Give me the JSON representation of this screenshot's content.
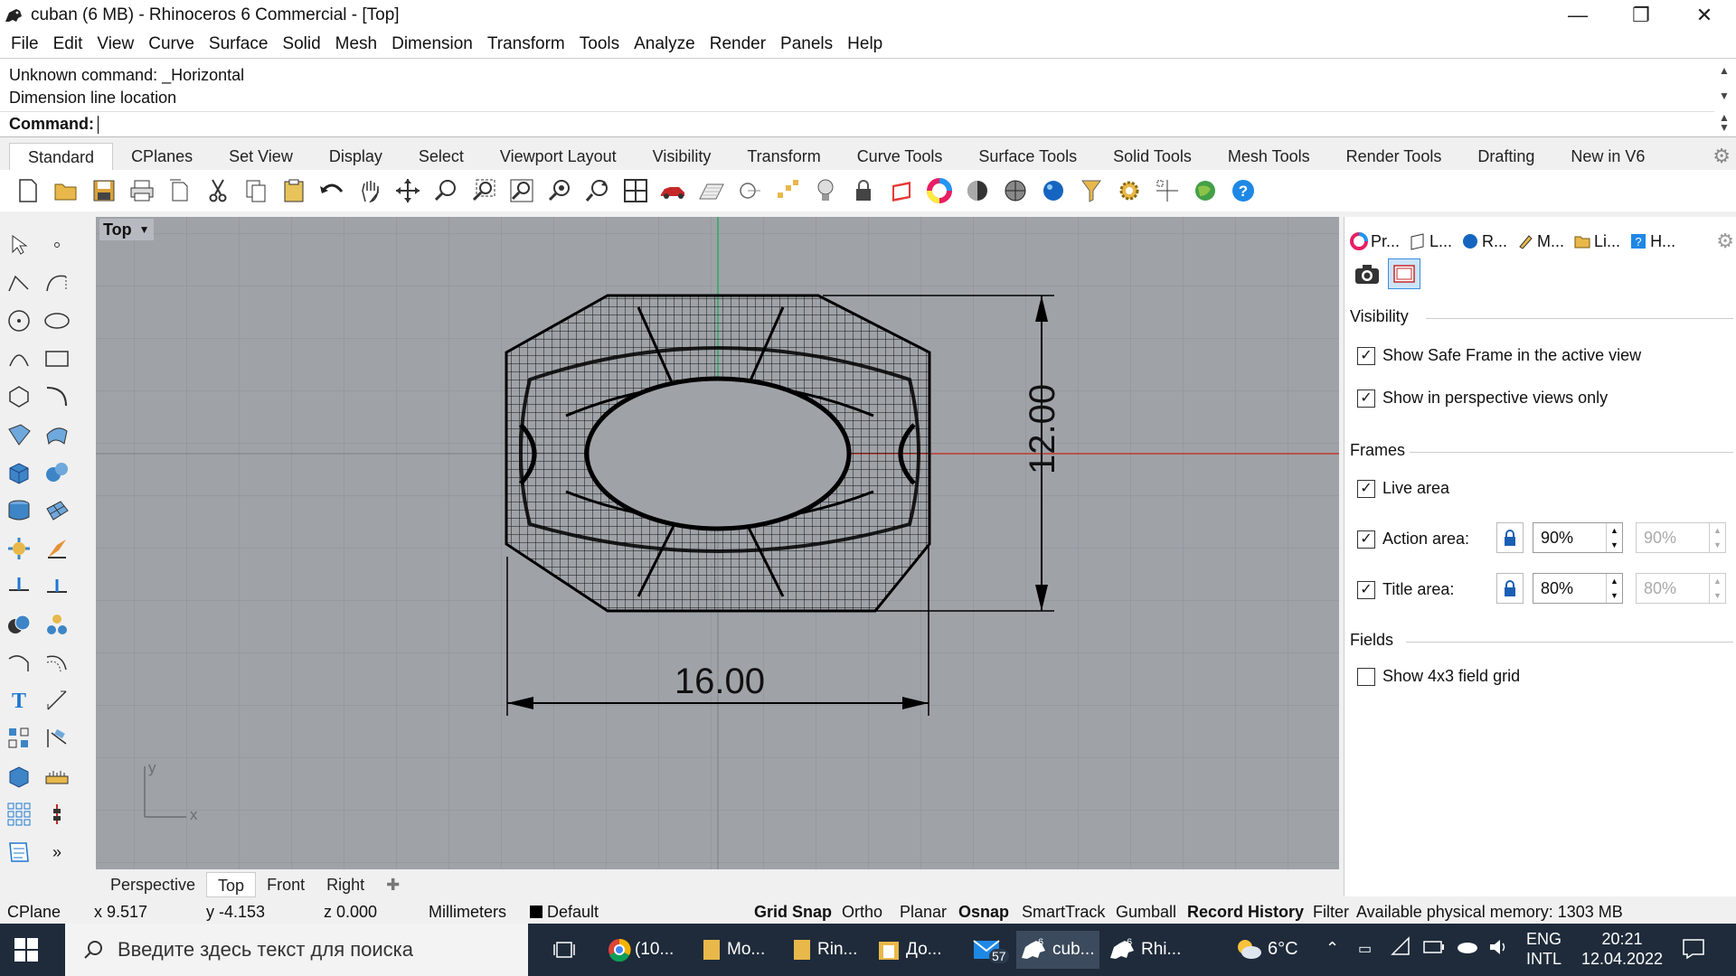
{
  "title": "cuban (6 MB) - Rhinoceros 6 Commercial - [Top]",
  "window_controls": {
    "minimize": "—",
    "maximize": "❐",
    "close": "✕"
  },
  "menu": [
    "File",
    "Edit",
    "View",
    "Curve",
    "Surface",
    "Solid",
    "Mesh",
    "Dimension",
    "Transform",
    "Tools",
    "Analyze",
    "Render",
    "Panels",
    "Help"
  ],
  "command": {
    "history": [
      "Unknown command: _Horizontal",
      "Dimension line location"
    ],
    "label": "Command:",
    "input_value": ""
  },
  "tabs": [
    "Standard",
    "CPlanes",
    "Set View",
    "Display",
    "Select",
    "Viewport Layout",
    "Visibility",
    "Transform",
    "Curve Tools",
    "Surface Tools",
    "Solid Tools",
    "Mesh Tools",
    "Render Tools",
    "Drafting",
    "New in V6"
  ],
  "active_tab": "Standard",
  "toolbar_icons": [
    "new-icon",
    "open-icon",
    "save-icon",
    "print-icon",
    "import-icon",
    "cut-icon",
    "copy-icon",
    "paste-icon",
    "undo-icon",
    "pan-icon",
    "rotate-view-icon",
    "zoom-icon",
    "zoom-window-icon",
    "zoom-extents-icon",
    "zoom-selected-icon",
    "rotate-icon",
    "four-views-icon",
    "car-icon",
    "cplane-icon",
    "osnap-icon",
    "points-icon",
    "light-icon",
    "lock-icon",
    "layer-icon",
    "color-wheel-icon",
    "shaded-icon",
    "rendered-icon",
    "render-sphere-icon",
    "filter-icon",
    "settings-gear-icon",
    "grid-icon",
    "globe-icon",
    "help-icon"
  ],
  "viewport": {
    "name": "Top",
    "dim_vertical": "12.00",
    "dim_horizontal": "16.00",
    "axis_y": "y",
    "axis_x": "x"
  },
  "viewport_tabs": [
    "Perspective",
    "Top",
    "Front",
    "Right"
  ],
  "active_viewport_tab": "Top",
  "panel": {
    "tabs": [
      "Pr...",
      "L...",
      "R...",
      "M...",
      "Li...",
      "H..."
    ],
    "visibility_header": "Visibility",
    "show_safe_frame": "Show Safe Frame in the active view",
    "show_in_perspective": "Show in perspective views only",
    "frames_header": "Frames",
    "live_area": "Live area",
    "action_area": "Action area:",
    "action_value": "90%",
    "action_value2": "90%",
    "title_area": "Title area:",
    "title_value": "80%",
    "title_value2": "80%",
    "fields_header": "Fields",
    "show_field_grid": "Show 4x3 field grid"
  },
  "status": {
    "cplane": "CPlane",
    "x": "x 9.517",
    "y": "y -4.153",
    "z": "z 0.000",
    "units": "Millimeters",
    "layer": "Default",
    "grid_snap": "Grid Snap",
    "ortho": "Ortho",
    "planar": "Planar",
    "osnap": "Osnap",
    "smarttrack": "SmartTrack",
    "gumball": "Gumball",
    "record_history": "Record History",
    "filter": "Filter",
    "memory": "Available physical memory: 1303 MB"
  },
  "taskbar": {
    "search_placeholder": "Введите здесь текст для поиска",
    "items": [
      "(10...",
      "Mo...",
      "Rin...",
      "До...",
      "cub...",
      "Rhi..."
    ],
    "mail_badge": "57",
    "weather": "6°C",
    "lang1": "ENG",
    "lang2": "INTL",
    "time": "20:21",
    "date": "12.04.2022"
  },
  "colors": {
    "x_axis": "#c0392b",
    "y_axis": "#27ae60",
    "viewport_bg": "#9fa3a8"
  }
}
